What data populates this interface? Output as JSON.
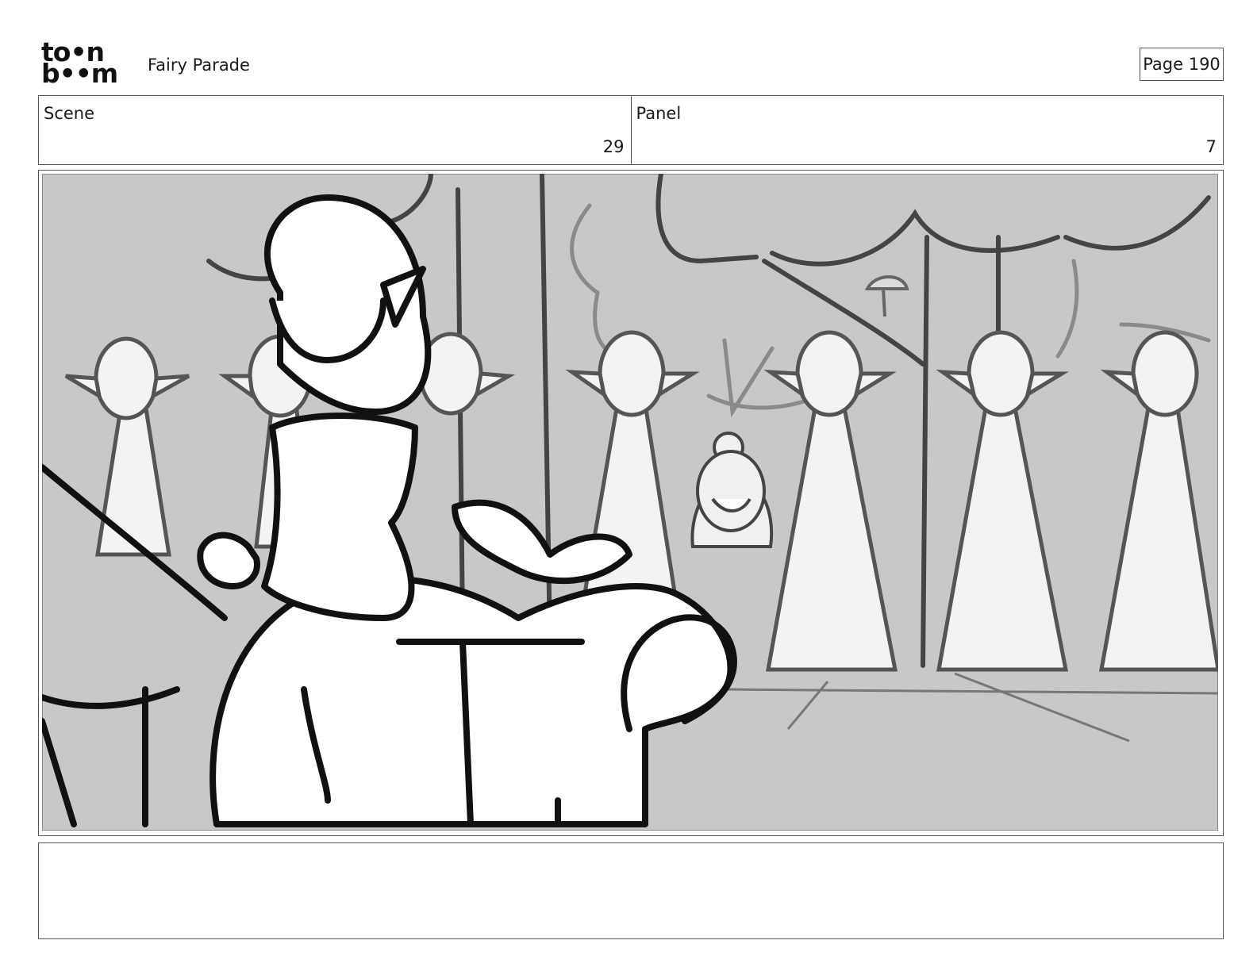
{
  "header": {
    "logo_line1": "to•n",
    "logo_line2": "b••m",
    "project_title": "Fairy Parade",
    "page_label": "Page 190"
  },
  "info": {
    "scene_label": "Scene",
    "scene_value": "29",
    "panel_label": "Panel",
    "panel_value": "7"
  },
  "panel": {
    "background_color": "#c8c8c8",
    "line_color": "#111111",
    "secondary_line_color": "#555555"
  },
  "notes": {
    "text": ""
  }
}
